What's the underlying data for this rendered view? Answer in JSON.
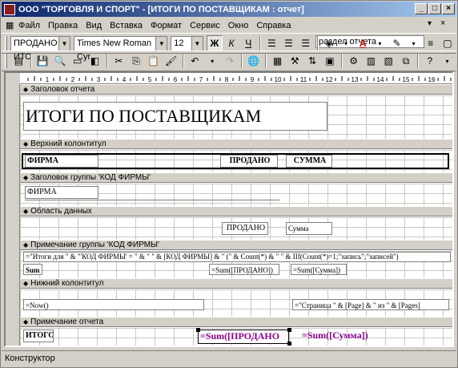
{
  "window": {
    "title": "ООО \"ТОРГОВЛЯ И СПОРТ\" - [ИТОГИ ПО ПОСТАВЩИКАМ : отчет]"
  },
  "menu": [
    "Файл",
    "Правка",
    "Вид",
    "Вставка",
    "Формат",
    "Сервис",
    "Окно",
    "Справка"
  ],
  "helpbox": {
    "text": "раздел отчета"
  },
  "format_toolbar": {
    "object": "ПРОДАНО ИТО",
    "font": "Times New Roman Cyr",
    "size": "12",
    "bold": "Ж",
    "italic": "К",
    "underline": "Ч"
  },
  "sections": {
    "report_header": "Заголовок отчета",
    "page_header": "Верхний колонтитул",
    "group_header": "Заголовок группы 'КОД ФИРМЫ'",
    "detail": "Область данных",
    "group_footer": "Примечание группы 'КОД ФИРМЫ'",
    "page_footer": "Нижний колонтитул",
    "report_footer": "Примечание отчета"
  },
  "controls": {
    "title": "ИТОГИ ПО ПОСТАВЩИКАМ",
    "ph_firm": "ФИРМА",
    "ph_sold": "ПРОДАНО",
    "ph_sum": "СУММА",
    "gh_firm": "ФИРМА",
    "d_sold": "ПРОДАНО",
    "d_sum": "Сумма",
    "gf_expr": "=\"Итоги для \" & \"'КОД ФИРМЫ' = \" & \" \" & [КОД ФИРМЫ] & \" (\" & Count(*) & \" \" & IIf(Count(*)=1;\"запись\";\"записей\")",
    "gf_sum_label": "Sum",
    "gf_sum_sold": "=Sum([ПРОДАНО])",
    "gf_sum_sum": "=Sum([Сумма])",
    "pf_now": "=Now()",
    "pf_page": "=\"Страница \" & [Page] & \" из \" & [Pages]",
    "rf_total": "ИТОГО",
    "rf_sum_sold": "=Sum([ПРОДАНО",
    "rf_sum_sum": "=Sum([Сумма])"
  },
  "status": "Конструктор",
  "ruler": [
    "1",
    "2",
    "3",
    "4",
    "5",
    "6",
    "7",
    "8",
    "9",
    "10",
    "11",
    "12",
    "13",
    "14",
    "15",
    "16",
    "17"
  ]
}
